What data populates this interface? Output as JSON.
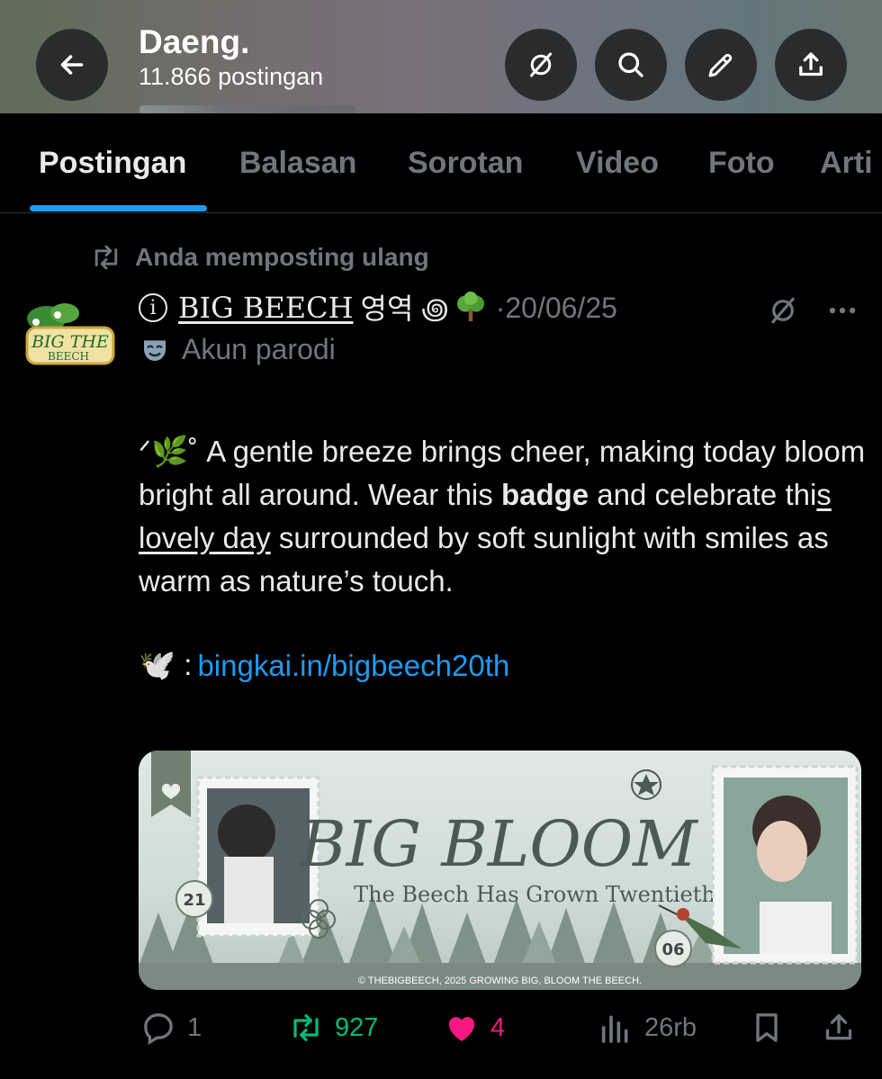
{
  "header": {
    "title": "Daeng.",
    "subtitle": "11.866 postingan"
  },
  "tabs": [
    {
      "label": "Postingan",
      "active": true
    },
    {
      "label": "Balasan"
    },
    {
      "label": "Sorotan"
    },
    {
      "label": "Video"
    },
    {
      "label": "Foto"
    },
    {
      "label": "Arti"
    }
  ],
  "post": {
    "repost_label": "Anda memposting ulang",
    "author_name": "BIG BEECH",
    "author_extra": "영역 ꩜",
    "date": "·20/06/25",
    "parody_label": "Akun parodi",
    "body": {
      "prefix": "ᐟ🌿˚ A gentle breeze brings cheer, making today bloom bright all around. Wear this ",
      "bold": "badge",
      "mid": " and celebrate thi",
      "underlined": "s lovely day",
      "suffix": " surrounded by soft sunlight with smiles as warm as nature’s touch."
    },
    "link_prefix": "🕊️ :",
    "link": "bingkai.in/bigbeech20th",
    "banner": {
      "title": "BIG BLOOM",
      "subtitle": "The Beech Has Grown Twentieth",
      "left_number": "21",
      "right_number": "06",
      "caption": "© THEBIGBEECH, 2025   GROWING BIG, BLOOM THE BEECH."
    },
    "avatar_text": "THE BIG BEECH"
  },
  "actions": {
    "replies": "1",
    "reposts": "927",
    "likes": "4",
    "views": "26rb"
  },
  "colors": {
    "accent": "#1d9bf0",
    "repost": "#00ba7c",
    "like": "#f91880",
    "muted": "#71767b"
  }
}
